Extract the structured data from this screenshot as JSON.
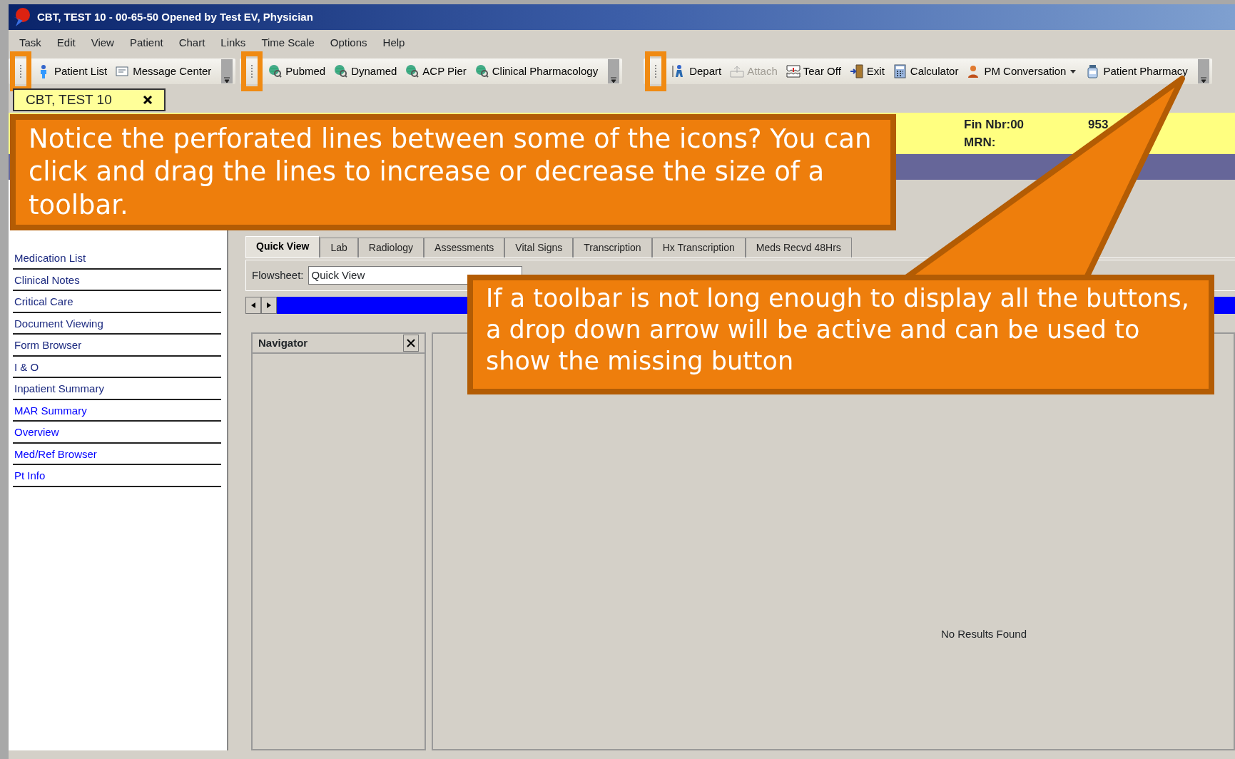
{
  "window": {
    "title": "CBT, TEST 10 - 00-65-50 Opened by Test EV, Physician"
  },
  "menu": [
    "Task",
    "Edit",
    "View",
    "Patient",
    "Chart",
    "Links",
    "Time Scale",
    "Options",
    "Help"
  ],
  "toolbars": [
    {
      "items": [
        {
          "label": "Patient List",
          "disabled": false,
          "dropdown": false
        },
        {
          "label": "Message Center",
          "disabled": false,
          "dropdown": false
        }
      ]
    },
    {
      "items": [
        {
          "label": "Pubmed",
          "disabled": false,
          "dropdown": false
        },
        {
          "label": "Dynamed",
          "disabled": false,
          "dropdown": false
        },
        {
          "label": "ACP Pier",
          "disabled": false,
          "dropdown": false
        },
        {
          "label": "Clinical Pharmacology",
          "disabled": false,
          "dropdown": false
        }
      ]
    },
    {
      "items": [
        {
          "label": "Depart",
          "disabled": false,
          "dropdown": false
        },
        {
          "label": "Attach",
          "disabled": true,
          "dropdown": false
        },
        {
          "label": "Tear Off",
          "disabled": false,
          "dropdown": false
        },
        {
          "label": "Exit",
          "disabled": false,
          "dropdown": false
        },
        {
          "label": "Calculator",
          "disabled": false,
          "dropdown": false
        },
        {
          "label": "PM Conversation",
          "disabled": false,
          "dropdown": true
        },
        {
          "label": "Patient Pharmacy",
          "disabled": false,
          "dropdown": false
        }
      ]
    }
  ],
  "patient_tab": {
    "label": "CBT, TEST 10"
  },
  "banner": {
    "fin": "Fin Nbr:00",
    "fin_tail": "953",
    "mrn": "MRN:"
  },
  "sidebar": {
    "items": [
      {
        "label": "Medication List",
        "visited": true
      },
      {
        "label": "Clinical Notes",
        "visited": true
      },
      {
        "label": "Critical Care",
        "visited": true
      },
      {
        "label": "Document Viewing",
        "visited": true
      },
      {
        "label": "Form Browser",
        "visited": true
      },
      {
        "label": "I & O",
        "visited": true
      },
      {
        "label": "Inpatient Summary",
        "visited": true
      },
      {
        "label": "MAR Summary",
        "visited": false
      },
      {
        "label": "Overview",
        "visited": false
      },
      {
        "label": "Med/Ref Browser",
        "visited": false
      },
      {
        "label": "Pt Info",
        "visited": false
      }
    ]
  },
  "tabs": [
    {
      "label": "Quick View",
      "selected": true
    },
    {
      "label": "Lab",
      "selected": false
    },
    {
      "label": "Radiology",
      "selected": false
    },
    {
      "label": "Assessments",
      "selected": false
    },
    {
      "label": "Vital Signs",
      "selected": false
    },
    {
      "label": "Transcription",
      "selected": false
    },
    {
      "label": "Hx Transcription",
      "selected": false
    },
    {
      "label": "Meds Recvd 48Hrs",
      "selected": false
    }
  ],
  "flowsheet": {
    "label": "Flowsheet:",
    "value": "Quick View"
  },
  "navigator": {
    "title": "Navigator"
  },
  "results": {
    "message": "No Results Found"
  },
  "callouts": [
    {
      "text": "Notice the perforated lines between some of the icons? You can click and drag the lines to increase or decrease the size of a toolbar."
    },
    {
      "text": "If a toolbar is not long enough to display all the buttons, a drop down arrow will be active and can be used to show the missing button"
    }
  ]
}
